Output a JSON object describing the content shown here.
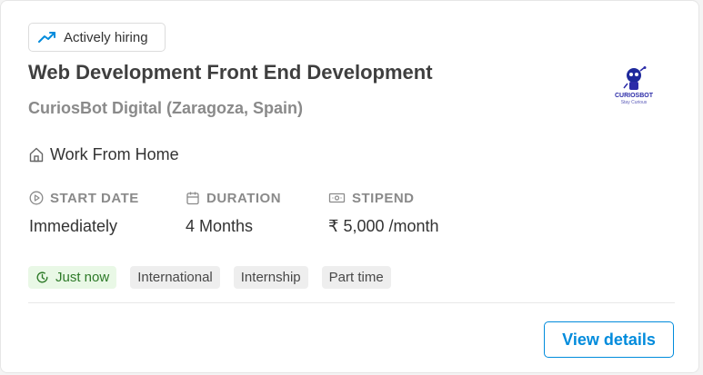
{
  "badge": {
    "label": "Actively hiring",
    "icon": "trending-up-icon"
  },
  "job": {
    "title": "Web Development Front End Development",
    "company": "CuriosBot Digital (Zaragoza, Spain)"
  },
  "logo": {
    "name": "CURIOSBOT",
    "tagline": "Stay Curious"
  },
  "location": {
    "icon": "home-icon",
    "text": "Work From Home"
  },
  "details": {
    "start_date": {
      "label": "START DATE",
      "value": "Immediately",
      "icon": "play-circle-icon"
    },
    "duration": {
      "label": "DURATION",
      "value": "4 Months",
      "icon": "calendar-icon"
    },
    "stipend": {
      "label": "STIPEND",
      "value": "₹ 5,000 /month",
      "icon": "money-icon"
    }
  },
  "tags": {
    "posted": "Just now",
    "tag1": "International",
    "tag2": "Internship",
    "tag3": "Part time"
  },
  "actions": {
    "view_details": "View details"
  },
  "colors": {
    "accent": "#008bdc",
    "success_bg": "#e9f8e6",
    "success_text": "#2d7a28",
    "muted_text": "#8a8a8a",
    "logo_blue": "#2c2ca8"
  }
}
